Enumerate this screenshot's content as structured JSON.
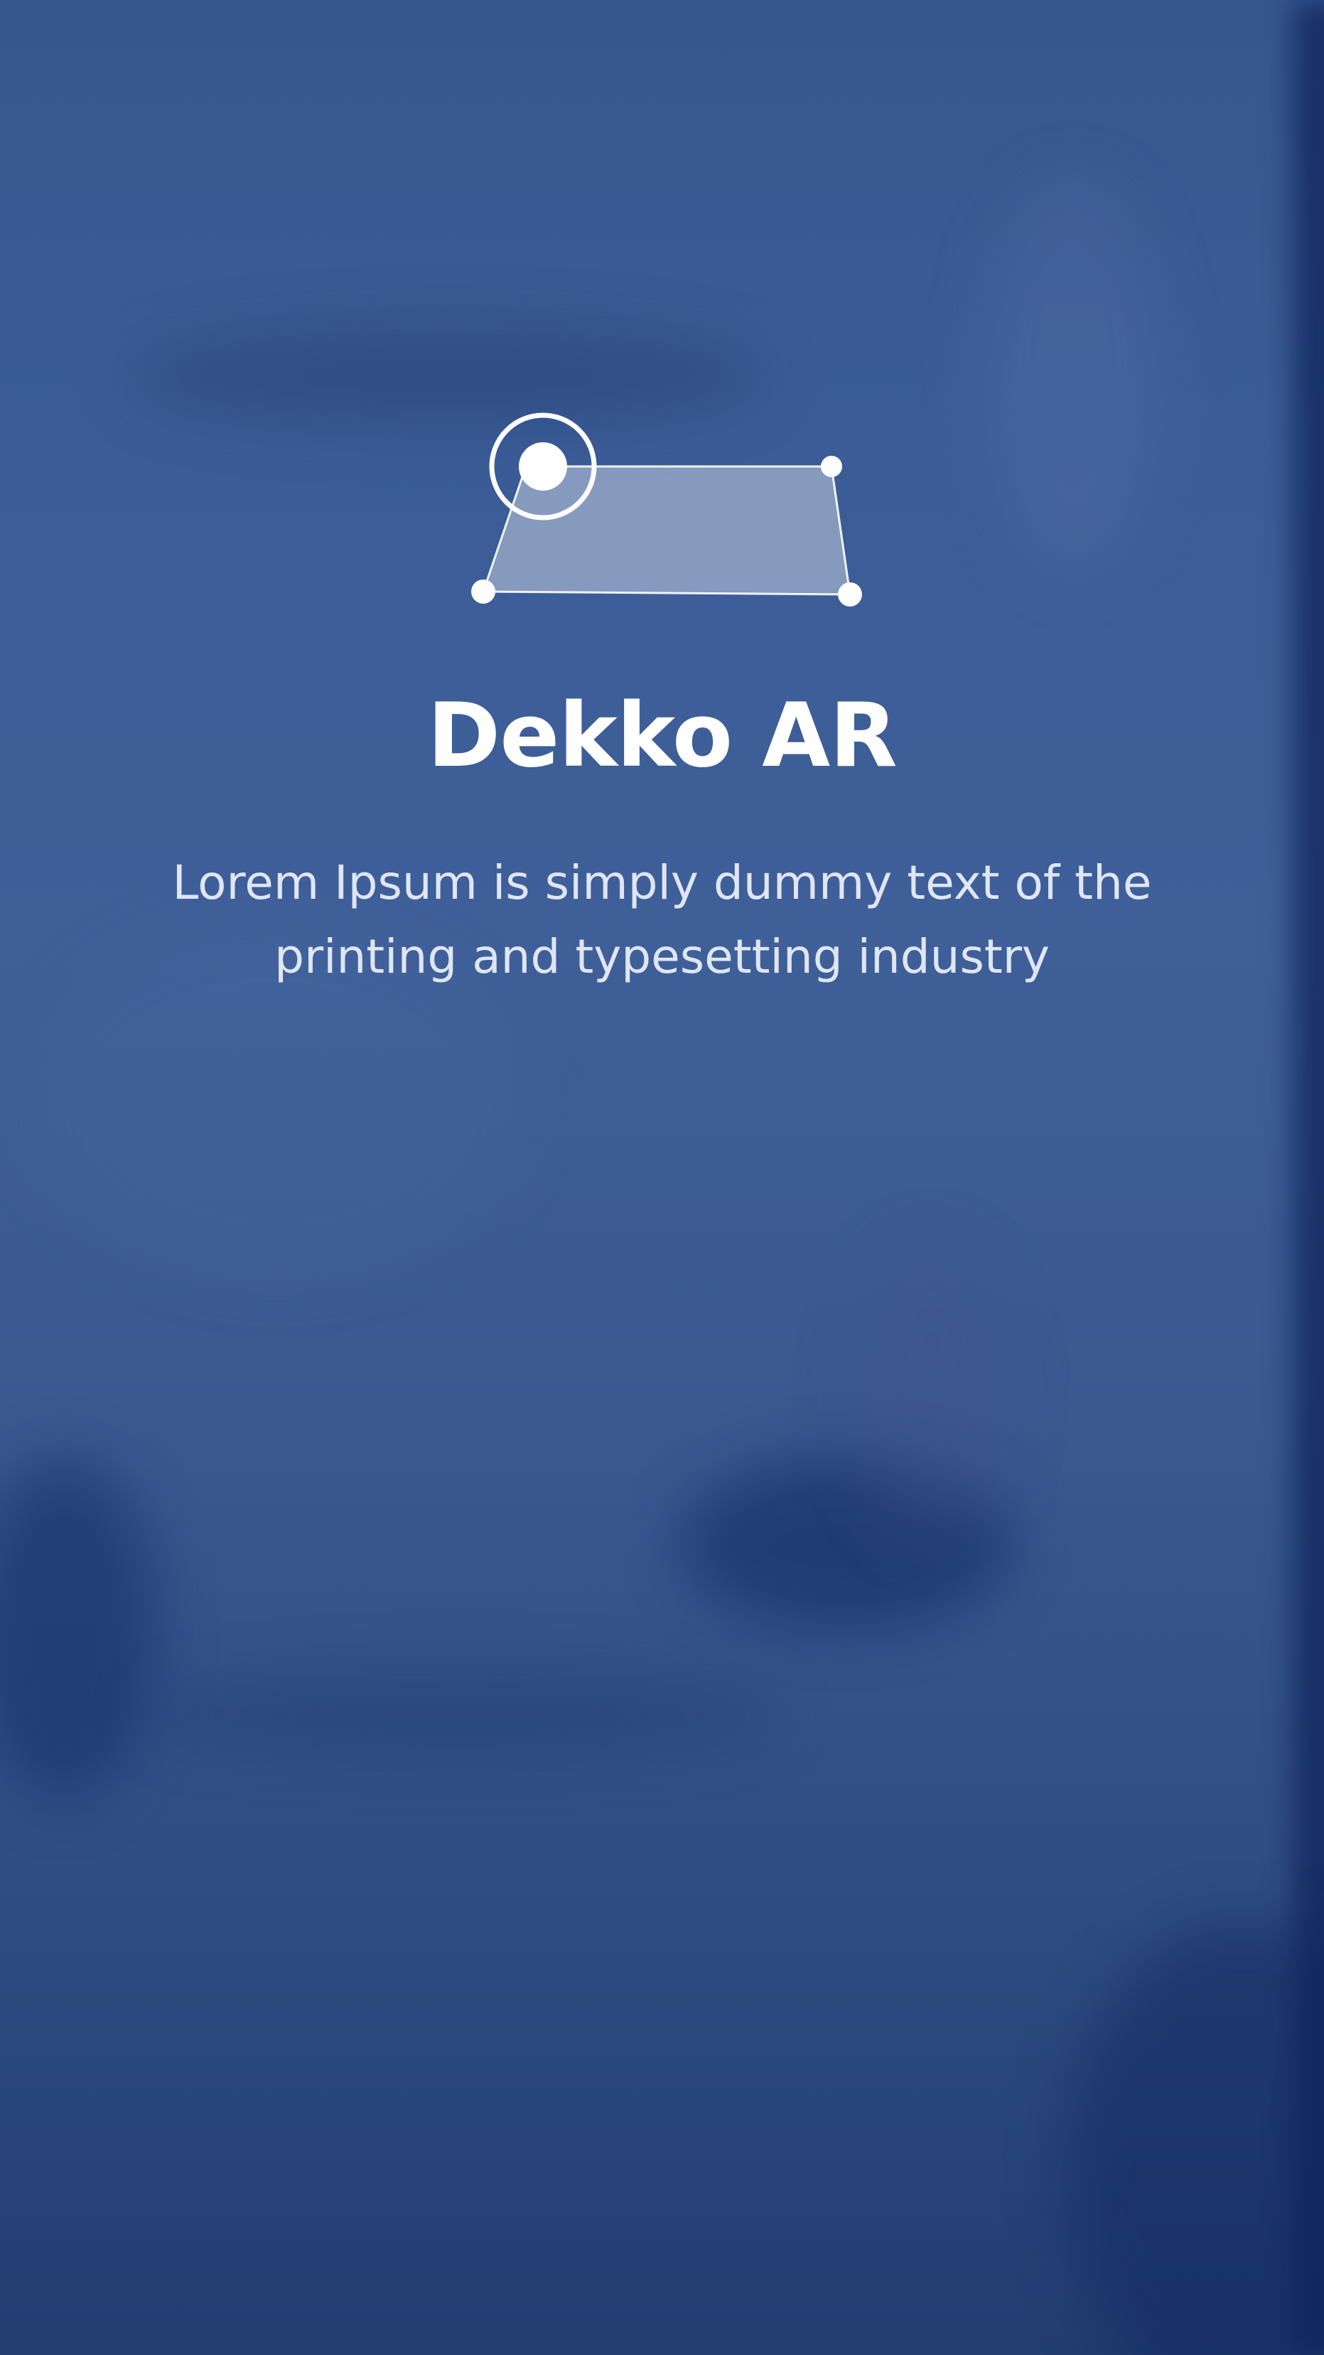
{
  "app": {
    "title": "Dekko AR",
    "description": "Lorem Ipsum is simply dummy text of the printing and typesetting industry"
  },
  "icons": {
    "logo": "ar-plane-detection-icon"
  },
  "colors": {
    "background": "#3a5a93",
    "title": "#ffffff",
    "subtitle": "#dfe6f3"
  }
}
